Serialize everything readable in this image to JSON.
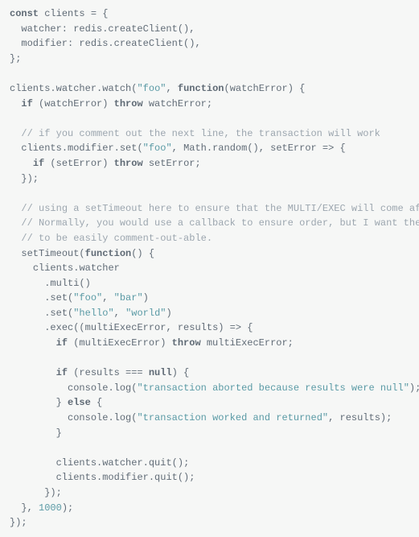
{
  "code": {
    "l1": {
      "kw_const": "const",
      "id": "clients",
      "eq": " = {"
    },
    "l2": {
      "id": "  watcher: redis",
      "dot": ".",
      "fn": "createClient",
      "rest": "(),"
    },
    "l3": {
      "id": "  modifier: redis",
      "dot": ".",
      "fn": "createClient",
      "rest": "(),"
    },
    "l4": {
      "txt": "};"
    },
    "l5": {
      "txt": ""
    },
    "l6": {
      "id1": "clients",
      "dot1": ".",
      "id2": "watcher",
      "dot2": ".",
      "fn": "watch",
      "open": "(",
      "str": "\"foo\"",
      "sep": ", ",
      "kw": "function",
      "args": "(watchError) {"
    },
    "l7": {
      "indent": "  ",
      "kw": "if",
      "open": " (watchError) ",
      "kw2": "throw",
      "rest": " watchError;"
    },
    "l8": {
      "txt": ""
    },
    "l9": {
      "indent": "  ",
      "cmt": "// if you comment out the next line, the transaction will work"
    },
    "l10": {
      "indent": "  ",
      "id": "clients",
      "dot": ".",
      "id2": "modifier",
      "dot2": ".",
      "fn": "set",
      "open": "(",
      "str": "\"foo\"",
      "sep": ", ",
      "id3": "Math",
      "dot3": ".",
      "fn2": "random",
      "rest": "(), setError => {"
    },
    "l11": {
      "indent": "    ",
      "kw": "if",
      "open": " (setError) ",
      "kw2": "throw",
      "rest": " setError;"
    },
    "l12": {
      "indent": "  ",
      "txt": "});"
    },
    "l13": {
      "txt": ""
    },
    "l14": {
      "indent": "  ",
      "cmt": "// using a setTimeout here to ensure that the MULTI/EXEC will come after the SET."
    },
    "l15": {
      "indent": "  ",
      "cmt": "// Normally, you would use a callback to ensure order, but I want the above SET command"
    },
    "l16": {
      "indent": "  ",
      "cmt": "// to be easily comment-out-able."
    },
    "l17": {
      "indent": "  ",
      "fn": "setTimeout",
      "open": "(",
      "kw": "function",
      "rest": "() {"
    },
    "l18": {
      "indent": "    ",
      "id": "clients",
      "dot": ".",
      "id2": "watcher"
    },
    "l19": {
      "indent": "      ",
      "dot": ".",
      "fn": "multi",
      "rest": "()"
    },
    "l20": {
      "indent": "      ",
      "dot": ".",
      "fn": "set",
      "open": "(",
      "str1": "\"foo\"",
      "sep": ", ",
      "str2": "\"bar\"",
      "close": ")"
    },
    "l21": {
      "indent": "      ",
      "dot": ".",
      "fn": "set",
      "open": "(",
      "str1": "\"hello\"",
      "sep": ", ",
      "str2": "\"world\"",
      "close": ")"
    },
    "l22": {
      "indent": "      ",
      "dot": ".",
      "fn": "exec",
      "rest": "((multiExecError, results) => {"
    },
    "l23": {
      "indent": "        ",
      "kw": "if",
      "open": " (multiExecError) ",
      "kw2": "throw",
      "rest": " multiExecError;"
    },
    "l24": {
      "txt": ""
    },
    "l25": {
      "indent": "        ",
      "kw": "if",
      "open": " (results === ",
      "null": "null",
      "close": ") {"
    },
    "l26": {
      "indent": "          ",
      "id": "console",
      "dot": ".",
      "fn": "log",
      "open": "(",
      "str": "\"transaction aborted because results were null\"",
      "close": ");"
    },
    "l27": {
      "indent": "        ",
      "txt": "} ",
      "kw": "else",
      "rest": " {"
    },
    "l28": {
      "indent": "          ",
      "id": "console",
      "dot": ".",
      "fn": "log",
      "open": "(",
      "str": "\"transaction worked and returned\"",
      "sep": ", results);"
    },
    "l29": {
      "indent": "        ",
      "txt": "}"
    },
    "l30": {
      "txt": ""
    },
    "l31": {
      "indent": "        ",
      "id": "clients",
      "dot": ".",
      "id2": "watcher",
      "dot2": ".",
      "fn": "quit",
      "rest": "();"
    },
    "l32": {
      "indent": "        ",
      "id": "clients",
      "dot": ".",
      "id2": "modifier",
      "dot2": ".",
      "fn": "quit",
      "rest": "();"
    },
    "l33": {
      "indent": "      ",
      "txt": "});"
    },
    "l34": {
      "indent": "  ",
      "txt": "}, ",
      "num": "1000",
      "rest": ");"
    },
    "l35": {
      "txt": "});"
    }
  }
}
